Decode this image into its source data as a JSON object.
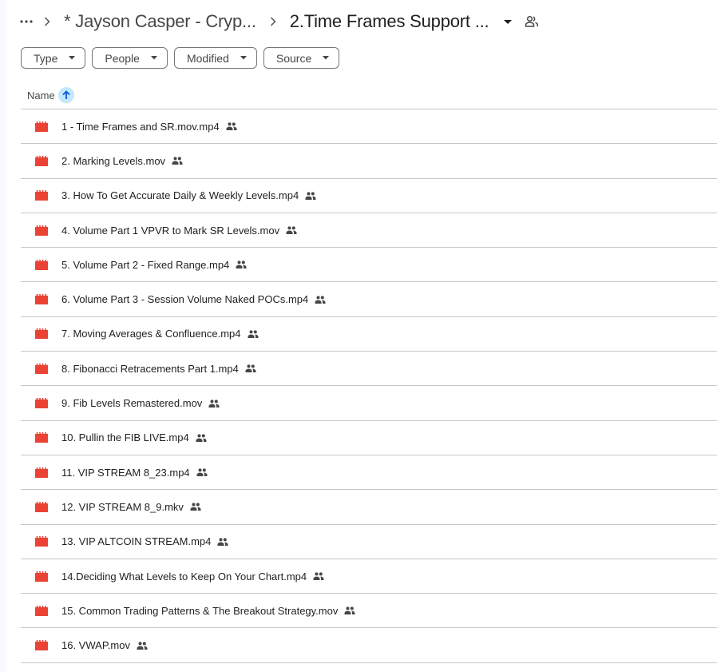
{
  "breadcrumb": {
    "more_icon": "more-horiz-icon",
    "items": [
      {
        "label": "* Jayson Casper - Cryp..."
      },
      {
        "label": "2.Time Frames Support ..."
      }
    ],
    "separator_icon": "chevron-right-icon",
    "dropdown_icon": "arrow-drop-down-icon",
    "share_icon": "shared-folder-people-icon"
  },
  "filters": [
    {
      "label": "Type"
    },
    {
      "label": "People"
    },
    {
      "label": "Modified"
    },
    {
      "label": "Source"
    }
  ],
  "columns": {
    "name_label": "Name",
    "sort_direction": "ascending",
    "sort_icon": "arrow-upward-icon"
  },
  "colors": {
    "video_icon": "#ea4335",
    "sort_highlight": "#c2e7ff",
    "sort_arrow": "#0b57d0"
  },
  "files": [
    {
      "name": "1 - Time Frames and SR.mov.mp4",
      "type": "video",
      "shared": true
    },
    {
      "name": "2. Marking Levels.mov",
      "type": "video",
      "shared": true
    },
    {
      "name": "3. How To Get Accurate Daily & Weekly Levels.mp4",
      "type": "video",
      "shared": true
    },
    {
      "name": "4. Volume Part 1 VPVR to Mark SR Levels.mov",
      "type": "video",
      "shared": true
    },
    {
      "name": "5. Volume Part 2 - Fixed Range.mp4",
      "type": "video",
      "shared": true
    },
    {
      "name": "6. Volume Part 3 - Session Volume Naked POCs.mp4",
      "type": "video",
      "shared": true
    },
    {
      "name": "7. Moving Averages & Confluence.mp4",
      "type": "video",
      "shared": true
    },
    {
      "name": "8. Fibonacci Retracements Part 1.mp4",
      "type": "video",
      "shared": true
    },
    {
      "name": "9. Fib Levels Remastered.mov",
      "type": "video",
      "shared": true
    },
    {
      "name": "10. Pullin the FIB LIVE.mp4",
      "type": "video",
      "shared": true
    },
    {
      "name": "11. VIP STREAM 8_23.mp4",
      "type": "video",
      "shared": true
    },
    {
      "name": "12. VIP STREAM 8_9.mkv",
      "type": "video",
      "shared": true
    },
    {
      "name": "13. VIP ALTCOIN STREAM.mp4",
      "type": "video",
      "shared": true
    },
    {
      "name": "14.Deciding What Levels to Keep On Your Chart.mp4",
      "type": "video",
      "shared": true
    },
    {
      "name": "15. Common Trading Patterns & The Breakout Strategy.mov",
      "type": "video",
      "shared": true
    },
    {
      "name": "16. VWAP.mov",
      "type": "video",
      "shared": true
    }
  ]
}
